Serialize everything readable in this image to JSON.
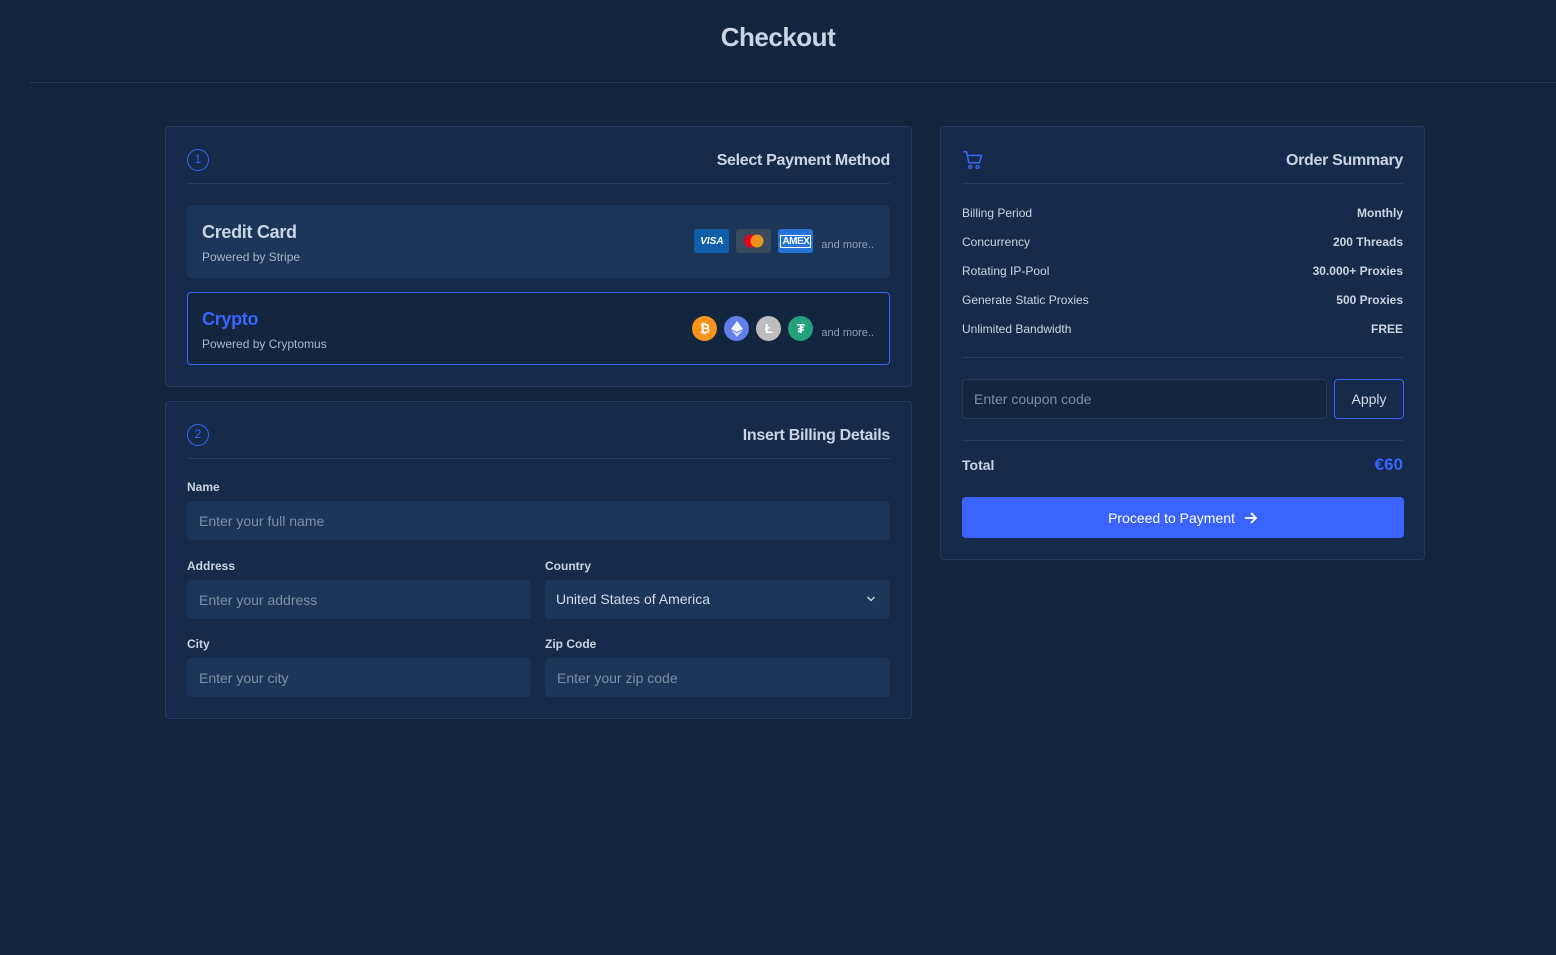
{
  "page": {
    "title": "Checkout"
  },
  "payment": {
    "step": "1",
    "title": "Select Payment Method",
    "methods": [
      {
        "title": "Credit Card",
        "subtitle": "Powered by Stripe",
        "logos": [
          "visa-icon",
          "mastercard-icon",
          "amex-icon"
        ],
        "more": "and more.."
      },
      {
        "title": "Crypto",
        "subtitle": "Powered by Cryptomus",
        "logos": [
          "bitcoin-icon",
          "ethereum-icon",
          "litecoin-icon",
          "tether-icon"
        ],
        "more": "and more.."
      }
    ],
    "visa_text": "VISA",
    "amex_text": "AMEX"
  },
  "billing": {
    "step": "2",
    "title": "Insert Billing Details",
    "name": {
      "label": "Name",
      "placeholder": "Enter your full name",
      "value": ""
    },
    "address": {
      "label": "Address",
      "placeholder": "Enter your address",
      "value": ""
    },
    "country": {
      "label": "Country",
      "value": "United States of America"
    },
    "city": {
      "label": "City",
      "placeholder": "Enter your city",
      "value": ""
    },
    "zip": {
      "label": "Zip Code",
      "placeholder": "Enter your zip code",
      "value": ""
    }
  },
  "summary": {
    "title": "Order Summary",
    "rows": [
      {
        "key": "Billing Period",
        "value": "Monthly"
      },
      {
        "key": "Concurrency",
        "value": "200 Threads"
      },
      {
        "key": "Rotating IP-Pool",
        "value": "30.000+ Proxies"
      },
      {
        "key": "Generate Static Proxies",
        "value": "500 Proxies"
      },
      {
        "key": "Unlimited Bandwidth",
        "value": "FREE"
      }
    ],
    "coupon_placeholder": "Enter coupon code",
    "apply_label": "Apply",
    "total_label": "Total",
    "total_value": "€60",
    "proceed_label": "Proceed to Payment"
  },
  "colors": {
    "background": "#12253e",
    "card": "#152b49",
    "input": "#1c3659",
    "accent": "#3a63ff"
  }
}
